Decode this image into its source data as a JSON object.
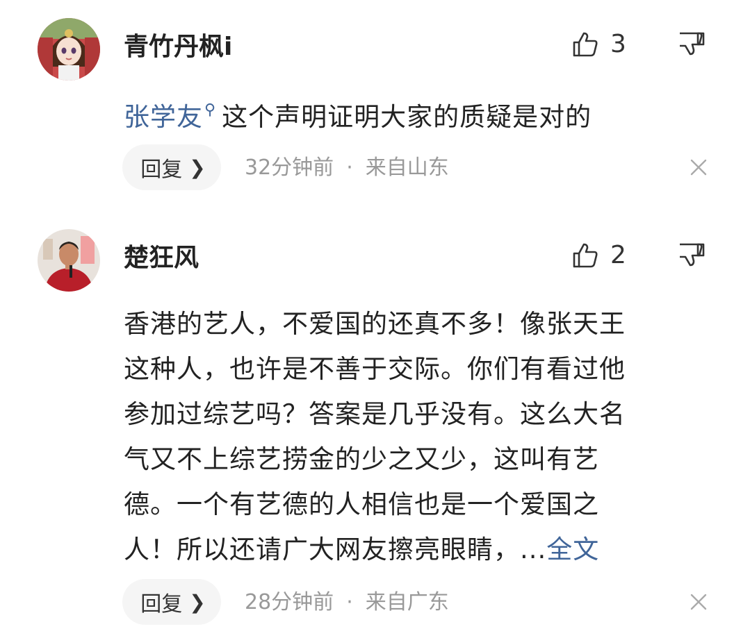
{
  "comments": [
    {
      "username": "青竹丹枫i",
      "likes": "3",
      "mention": "张学友",
      "text": "这个声明证明大家的质疑是对的",
      "reply_label": "回复",
      "time": "32分钟前",
      "separator": "·",
      "location": "来自山东"
    },
    {
      "username": "楚狂风",
      "likes": "2",
      "text_lines": [
        "香港的艺人，不爱国的还真不多！像张天王",
        "这种人，也许是不善于交际。你们有看过他",
        "参加过综艺吗？答案是几乎没有。这么大名",
        "气又不上综艺捞金的少之又少，这叫有艺",
        "德。一个有艺德的人相信也是一个爱国之"
      ],
      "last_line": "人！所以还请广大网友擦亮眼睛，...",
      "fulltext_label": "全文",
      "reply_label": "回复",
      "time": "28分钟前",
      "separator": "·",
      "location": "来自广东"
    }
  ],
  "icons": {
    "like": "thumbs-up-icon",
    "dislike": "thumbs-down-icon",
    "close": "close-icon",
    "search": "search-icon",
    "chevron": "chevron-right-icon"
  },
  "colors": {
    "mention": "#406599",
    "meta": "#999999",
    "reply_bg": "#f5f5f5"
  }
}
